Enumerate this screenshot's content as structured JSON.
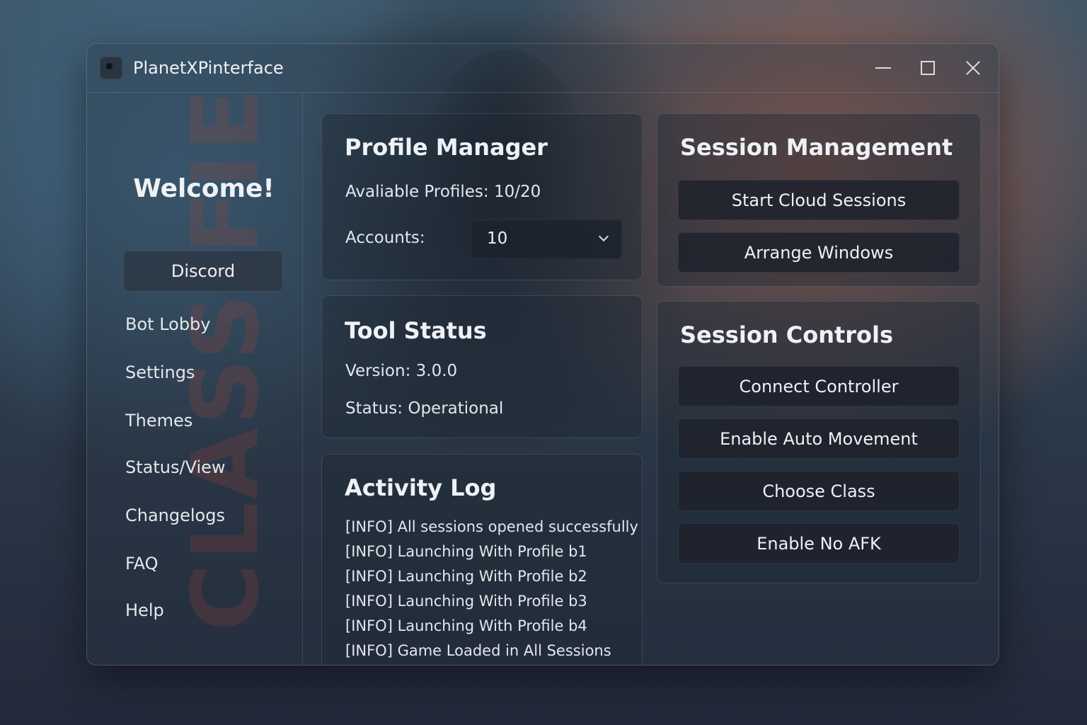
{
  "window": {
    "title": "PlanetXPinterface"
  },
  "sidebar": {
    "watermark": "CLASSIFIE",
    "welcome": "Welcome!",
    "discord_label": "Discord",
    "items": [
      {
        "label": "Bot Lobby"
      },
      {
        "label": "Settings"
      },
      {
        "label": "Themes"
      },
      {
        "label": "Status/View"
      },
      {
        "label": "Changelogs"
      },
      {
        "label": "FAQ"
      },
      {
        "label": "Help"
      }
    ]
  },
  "profile_manager": {
    "title": "Profile Manager",
    "available_profiles": "Avaliable Profiles: 10/20",
    "accounts_label": "Accounts:",
    "accounts_value": "10"
  },
  "tool_status": {
    "title": "Tool Status",
    "version": "Version: 3.0.0",
    "status": "Status: Operational"
  },
  "activity_log": {
    "title": "Activity Log",
    "lines": [
      "[INFO] All sessions opened successfully",
      "[INFO] Launching With Profile b1",
      "[INFO] Launching With Profile b2",
      "[INFO] Launching With Profile b3",
      "[INFO] Launching With Profile b4",
      "[INFO] Game Loaded in All Sessions"
    ]
  },
  "session_management": {
    "title": "Session Management",
    "buttons": [
      {
        "label": "Start Cloud Sessions"
      },
      {
        "label": "Arrange Windows"
      }
    ]
  },
  "session_controls": {
    "title": "Session Controls",
    "buttons": [
      {
        "label": "Connect Controller"
      },
      {
        "label": "Enable Auto Movement"
      },
      {
        "label": "Choose Class"
      },
      {
        "label": "Enable No AFK"
      }
    ]
  }
}
